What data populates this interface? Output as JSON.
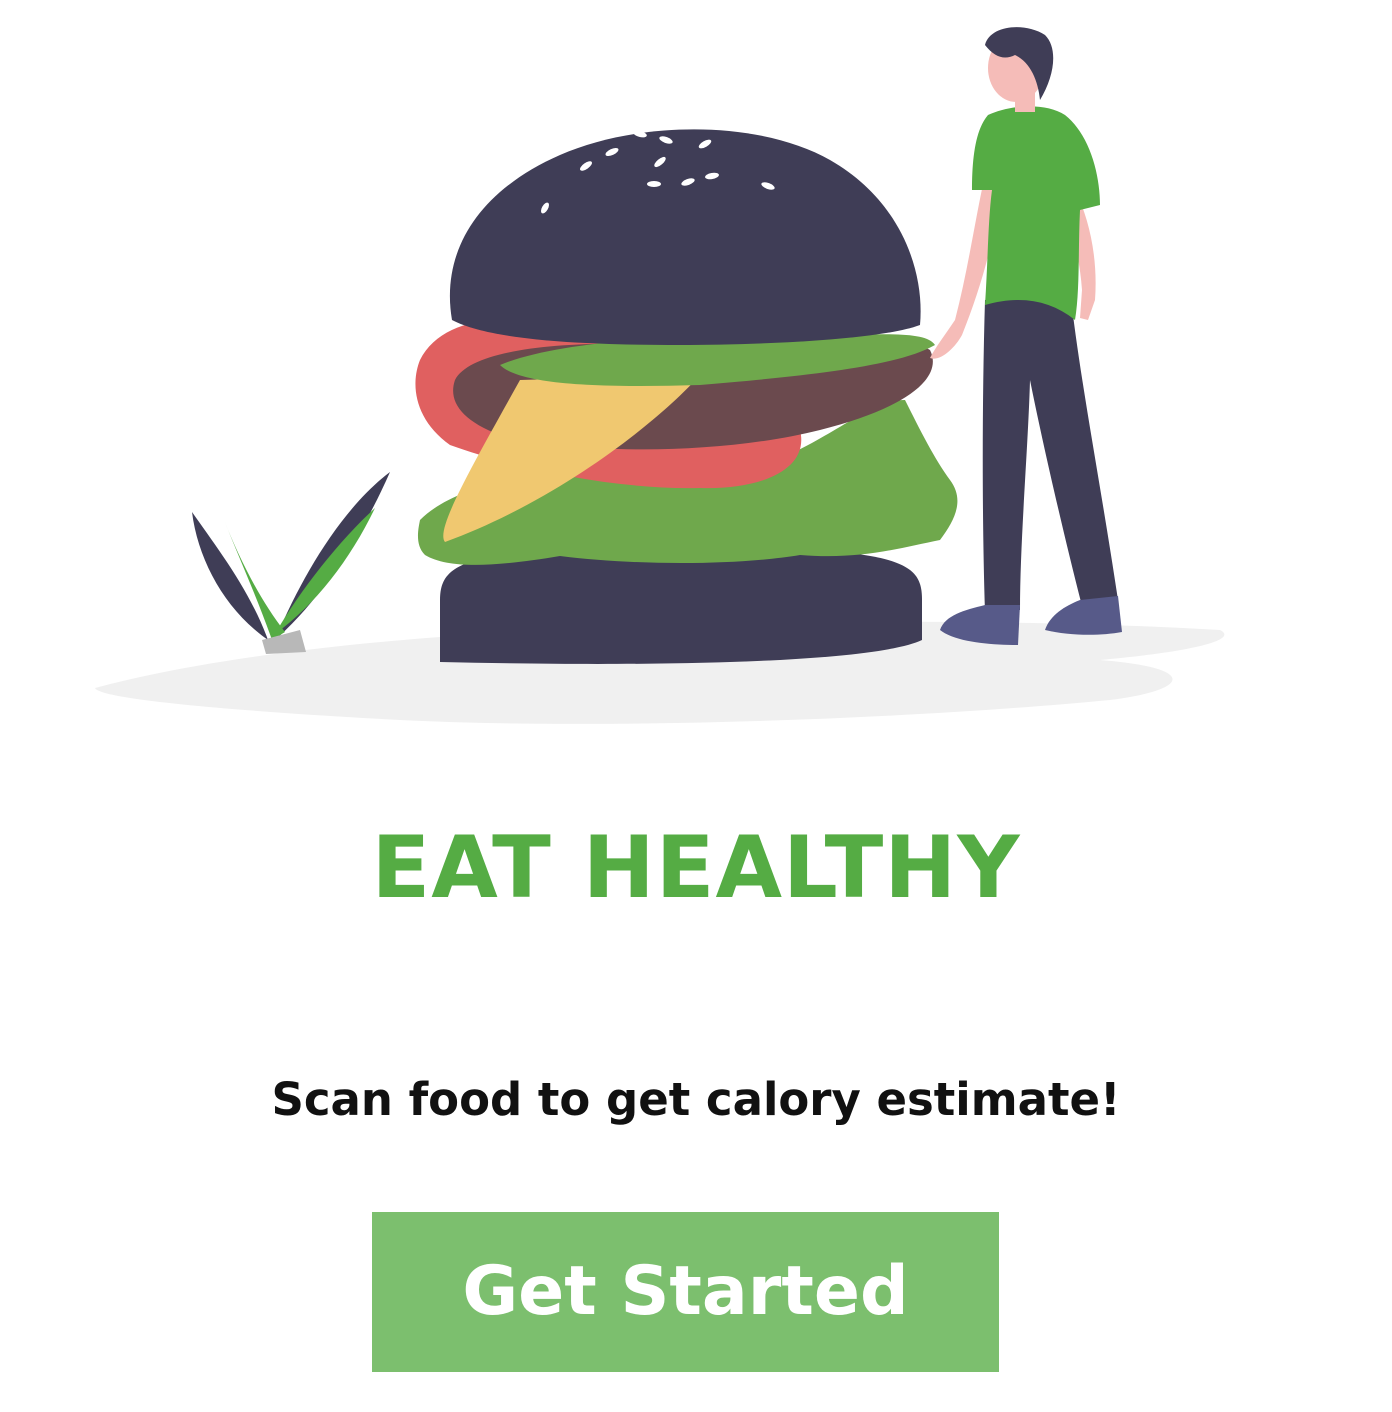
{
  "onboarding": {
    "illustration_name": "burger-and-person-illustration",
    "title": "EAT HEALTHY",
    "subtitle": "Scan food to get calory estimate!",
    "cta_label": "Get Started"
  },
  "colors": {
    "title": "#55ac44",
    "button_background": "#7cbf6e",
    "button_text": "#ffffff",
    "subtitle": "#111111",
    "illustration_dark": "#3f3d56",
    "illustration_green": "#55ac44",
    "illustration_tomato": "#e06060",
    "illustration_cheese": "#f0c870",
    "illustration_patty": "#6b4a4e",
    "illustration_skin": "#f5bcb8",
    "illustration_shoe": "#575a89"
  }
}
